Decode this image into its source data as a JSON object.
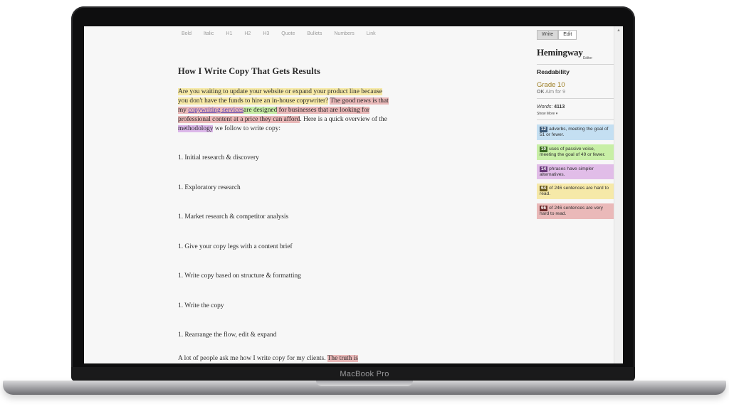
{
  "device": {
    "brand": "MacBook Pro"
  },
  "toolbar": {
    "items": [
      "Bold",
      "Italic",
      "H1",
      "H2",
      "H3",
      "Quote",
      "Bullets",
      "Numbers",
      "Link"
    ]
  },
  "document": {
    "title": "How I Write Copy That Gets Results",
    "p1": {
      "s1": "Are you waiting to update your website or expand your product line because you don't have the funds to hire an in-house copywriter?",
      "s2a": "The good news is that my",
      "link": "copywriting services",
      "s2b": "are designed",
      "s2c": "for businesses that are looking for professional content at a price they can afford",
      "s3a": ". Here is a quick overview of the",
      "s3b": "methodology",
      "s3c": "we follow to write copy:"
    },
    "list": [
      "1.  Initial research & discovery",
      "1.  Exploratory research",
      "1.  Market research & competitor analysis",
      "1.  Give your copy legs with a content brief",
      "1.  Write copy based on structure & formatting",
      "1.  Write the copy",
      "1.  Rearrange the flow, edit & expand"
    ],
    "closing_a": "A lot of people ask me how I write copy for my clients.",
    "closing_b": "The truth is"
  },
  "sidebar": {
    "modes": {
      "write": "Write",
      "edit": "Edit"
    },
    "logo": "Hemingway",
    "logo_sub": "Editor",
    "readability_label": "Readability",
    "grade": "Grade 10",
    "ok": "OK",
    "aim": "Aim for 9",
    "words_label": "Words",
    "words_value": "4113",
    "show_more": "Show More",
    "cards": [
      {
        "count": "12",
        "text": "adverbs, meeting the goal of 51 or fewer.",
        "bg": "#c4dff2",
        "badge_bg": "#3c5a78"
      },
      {
        "count": "10",
        "text": "uses of passive voice, meeting the goal of 49 or fewer.",
        "bg": "#c8efa6",
        "badge_bg": "#3a6a22"
      },
      {
        "count": "14",
        "text": "phrases have simpler alternatives.",
        "bg": "#e1bde8",
        "badge_bg": "#6a3a7a"
      },
      {
        "count": "64",
        "text": "of 246 sentences are hard to read.",
        "bg": "#f6e9a8",
        "badge_bg": "#6a5a1e"
      },
      {
        "count": "66",
        "text": "of 246 sentences are very hard to read.",
        "bg": "#eab9b9",
        "badge_bg": "#6e2c2c"
      }
    ]
  },
  "colors": {
    "highlight_yellow": "#f6e9a6",
    "highlight_red": "#e9b8b8",
    "highlight_green": "#c6eca4",
    "highlight_purple": "#dcb8ea",
    "grade_color": "#9a7b1f"
  }
}
